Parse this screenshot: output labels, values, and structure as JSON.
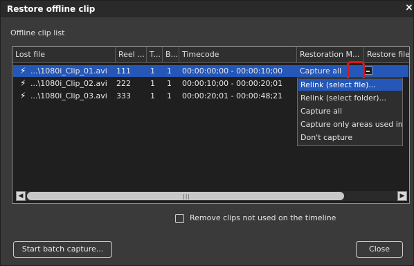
{
  "dialog": {
    "title": "Restore offline clip",
    "close_glyph": "×",
    "section_label": "Offline clip list"
  },
  "table": {
    "columns": [
      "Lost file",
      "Reel ...",
      "T...",
      "B...",
      "Timecode",
      "Restoration M...",
      "Restore file"
    ],
    "rows": [
      {
        "file": "...\\1080i_Clip_01.avi",
        "reel": "111",
        "t": "1",
        "b": "1",
        "timecode": "00:00:00;00 - 00:00:10;00",
        "restoration": "Capture all"
      },
      {
        "file": "...\\1080i_Clip_02.avi",
        "reel": "222",
        "t": "1",
        "b": "1",
        "timecode": "00:00:10;00 - 00:00:20;01",
        "restoration": ""
      },
      {
        "file": "...\\1080i_Clip_03.avi",
        "reel": "333",
        "t": "1",
        "b": "1",
        "timecode": "00:00:20;01 - 00:00:48;21",
        "restoration": ""
      }
    ],
    "row_icon": "lightning-offline-icon"
  },
  "dropdown": {
    "options": [
      "Relink (select file)...",
      "Relink (select folder)...",
      "Capture all",
      "Capture only areas used in",
      "Don't capture"
    ],
    "highlighted": 0
  },
  "checkbox": {
    "label": "Remove clips not used on the timeline",
    "checked": false
  },
  "buttons": {
    "batch": "Start batch capture...",
    "close": "Close"
  },
  "colors": {
    "selection": "#2557b8",
    "highlight_ring": "#d8181e"
  }
}
